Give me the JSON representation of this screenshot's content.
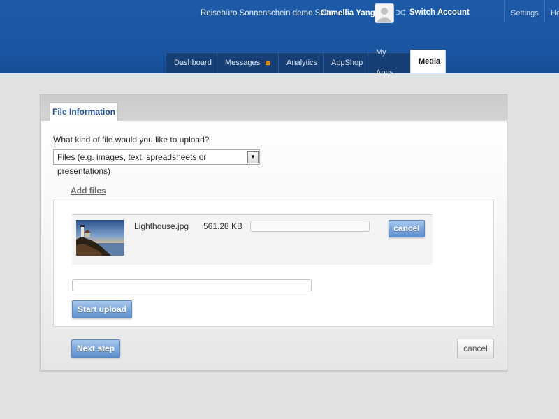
{
  "header": {
    "site_title": "Reisebüro Sonnenschein demo Seite",
    "user_name": "Camellia Yang",
    "switch_account": "Switch Account",
    "settings": "Settings",
    "help": "Help"
  },
  "nav": {
    "tabs": [
      {
        "label": "Dashboard"
      },
      {
        "label": "Messages",
        "icon": "envelope-icon"
      },
      {
        "label": "Analytics"
      },
      {
        "label": "AppShop"
      },
      {
        "label": "My Apps"
      },
      {
        "label": "Media",
        "active": true
      }
    ]
  },
  "panel": {
    "tab_label": "File Information",
    "question": "What kind of file would you like to upload?",
    "file_type_selected": "Files (e.g. images, text, spreadsheets or presentations)",
    "add_files": "Add files",
    "files": [
      {
        "name": "Lighthouse.jpg",
        "size": "561.28 KB",
        "cancel_label": "cancel",
        "thumbnail": "lighthouse-thumbnail"
      }
    ],
    "start_upload": "Start upload",
    "next_step": "Next step",
    "cancel": "cancel"
  },
  "colors": {
    "header_blue": "#1a55a2",
    "nav_tab_bg": "#163f76",
    "button_blue": "#7fa9dd",
    "page_bg": "#e2e2e2"
  }
}
